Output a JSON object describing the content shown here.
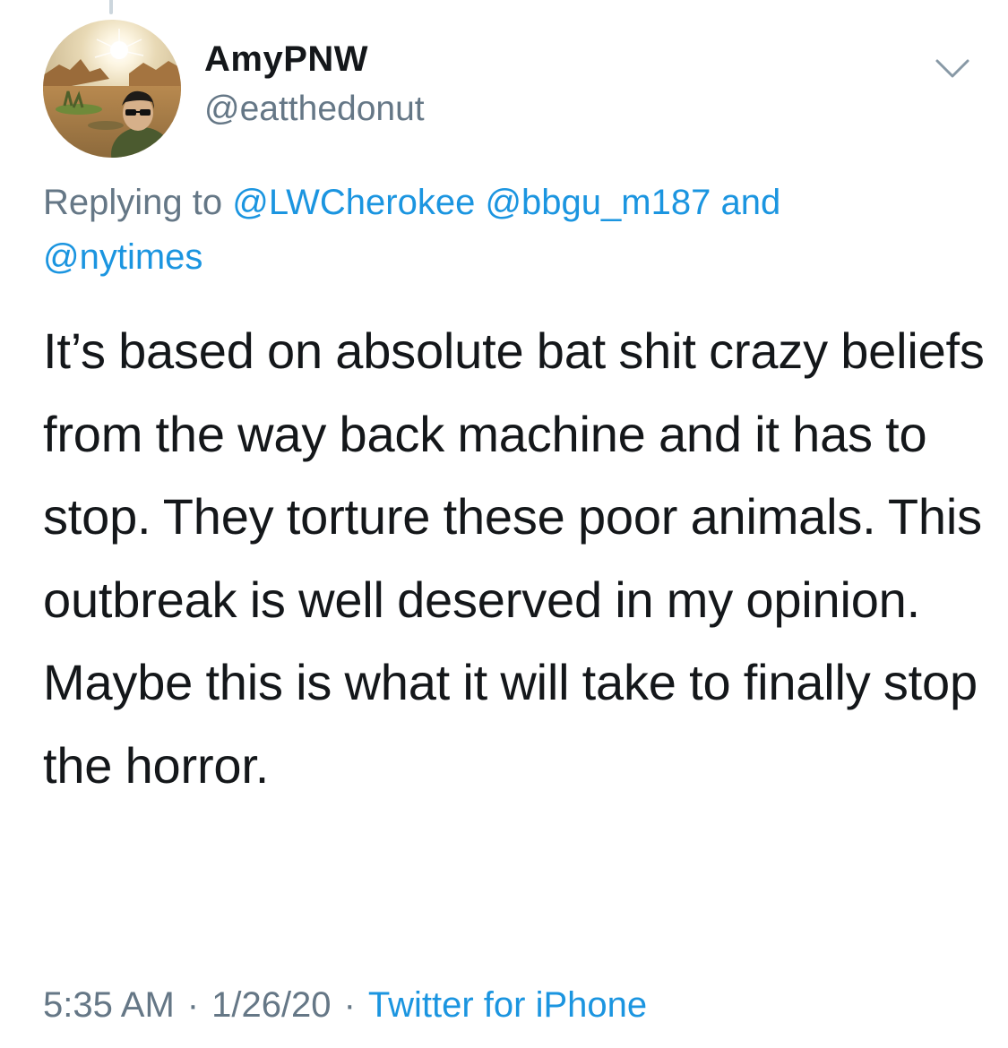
{
  "tweet": {
    "author": {
      "display_name": "AmyPNW",
      "handle": "@eatthedonut",
      "avatar_icon": "profile-photo-desert-selfie"
    },
    "reply_context": {
      "prefix": "Replying to",
      "mentions": [
        "@LWCherokee",
        "@bbgu_m187",
        "@nytimes"
      ],
      "conjunction": "and"
    },
    "text": "It’s based on absolute bat shit crazy beliefs from the way back machine and it has to stop. They torture these poor animals. This outbreak is well deserved in my opinion. Maybe this is what it will take to finally stop the horror.",
    "time": "5:35 AM",
    "date": "1/26/20",
    "separator": "·",
    "source": "Twitter for iPhone",
    "menu_icon": "chevron-down-icon"
  },
  "colors": {
    "link": "#1b95e0",
    "secondary_text": "#657786",
    "primary_text": "#14171a",
    "thread_line": "#ccd6dd"
  }
}
